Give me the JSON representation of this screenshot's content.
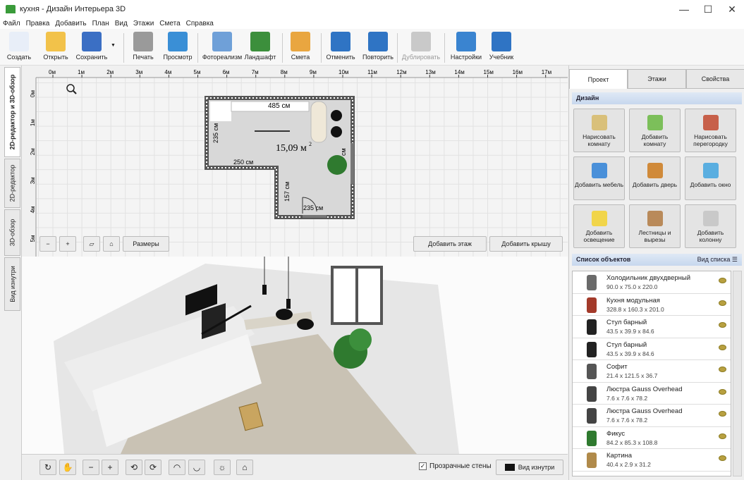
{
  "window": {
    "title": "кухня - Дизайн Интерьера 3D",
    "min": "—",
    "max": "☐",
    "close": "✕"
  },
  "menu": [
    "Файл",
    "Правка",
    "Добавить",
    "План",
    "Вид",
    "Этажи",
    "Смета",
    "Справка"
  ],
  "toolbar": [
    {
      "label": "Создать",
      "icon": "new-file-icon",
      "color": "#e8eef8"
    },
    {
      "label": "Открыть",
      "icon": "folder-icon",
      "color": "#f2c24a"
    },
    {
      "label": "Сохранить",
      "icon": "floppy-icon",
      "color": "#3b6fc4"
    },
    {
      "label": "Печать",
      "icon": "printer-icon",
      "color": "#9a9a9a"
    },
    {
      "label": "Просмотр",
      "icon": "monitor-icon",
      "color": "#3a8fd6"
    },
    {
      "label": "Фотореализм",
      "icon": "photo-icon",
      "color": "#6fa0d8"
    },
    {
      "label": "Ландшафт",
      "icon": "tree-icon",
      "color": "#3c8f3c"
    },
    {
      "label": "Смета",
      "icon": "estimate-icon",
      "color": "#e9a640"
    },
    {
      "label": "Отменить",
      "icon": "undo-icon",
      "color": "#2f74c4"
    },
    {
      "label": "Повторить",
      "icon": "redo-icon",
      "color": "#2f74c4"
    },
    {
      "label": "Дублировать",
      "icon": "duplicate-icon",
      "color": "#c9c9c9"
    },
    {
      "label": "Настройки",
      "icon": "gear-icon",
      "color": "#3a84d0"
    },
    {
      "label": "Учебник",
      "icon": "help-icon",
      "color": "#2f74c4"
    }
  ],
  "left_tabs": [
    "2D-редактор и 3D-обзор",
    "2D-редактор",
    "3D-обзор",
    "Вид изнутри"
  ],
  "ruler_x": [
    "0м",
    "1м",
    "2м",
    "3м",
    "4м",
    "5м",
    "6м",
    "7м",
    "8м",
    "9м",
    "10м",
    "11м",
    "12м",
    "13м",
    "14м",
    "15м",
    "16м",
    "17м"
  ],
  "ruler_y": [
    "0м",
    "1м",
    "2м",
    "3м",
    "4м",
    "5м"
  ],
  "plan": {
    "dim_top": "485 см",
    "dim_left": "235 см",
    "area": "15,09 м",
    "area_sup": "2",
    "dim_mid": "250 см",
    "dim_vert": "157 см",
    "dim_bottom": "235 см",
    "dim_right": "см",
    "sizes_label": "Размеры",
    "add_floor": "Добавить этаж",
    "add_roof": "Добавить крышу"
  },
  "right_tabs": [
    "Проект",
    "Этажи",
    "Свойства"
  ],
  "design_header": "Дизайн",
  "design_buttons": [
    {
      "label": "Нарисовать комнату",
      "icon": "draw-room-icon",
      "color": "#d9c07a"
    },
    {
      "label": "Добавить комнату",
      "icon": "add-room-icon",
      "color": "#7cbf5a"
    },
    {
      "label": "Нарисовать перегородку",
      "icon": "brick-wall-icon",
      "color": "#c7604a"
    },
    {
      "label": "Добавить мебель",
      "icon": "armchair-icon",
      "color": "#4a90d9"
    },
    {
      "label": "Добавить дверь",
      "icon": "door-icon",
      "color": "#d08a3a"
    },
    {
      "label": "Добавить окно",
      "icon": "window-icon",
      "color": "#5aaee0"
    },
    {
      "label": "Добавить освещение",
      "icon": "bulb-icon",
      "color": "#f1d54a"
    },
    {
      "label": "Лестницы и вырезы",
      "icon": "stairs-icon",
      "color": "#b98a5a"
    },
    {
      "label": "Добавить колонну",
      "icon": "column-icon",
      "color": "#c9c9c9"
    }
  ],
  "objects_header": "Список объектов",
  "list_view": "Вид списка",
  "objects": [
    {
      "name": "Холодильник двухдверный",
      "dims": "90.0 x 75.0 x 220.0",
      "icon": "fridge-icon",
      "color": "#6a6a6a"
    },
    {
      "name": "Кухня модульная",
      "dims": "328.8 x 160.3 x 201.0",
      "icon": "kitchen-icon",
      "color": "#a33a2a"
    },
    {
      "name": "Стул барный",
      "dims": "43.5 x 39.9 x 84.6",
      "icon": "bar-stool-icon",
      "color": "#222222"
    },
    {
      "name": "Стул барный",
      "dims": "43.5 x 39.9 x 84.6",
      "icon": "bar-stool-icon",
      "color": "#222222"
    },
    {
      "name": "Софит",
      "dims": "21.4 x 121.5 x 36.7",
      "icon": "spotlight-icon",
      "color": "#555555"
    },
    {
      "name": "Люстра Gauss Overhead",
      "dims": "7.6 x 7.6 x 78.2",
      "icon": "pendant-lamp-icon",
      "color": "#444444"
    },
    {
      "name": "Люстра Gauss Overhead",
      "dims": "7.6 x 7.6 x 78.2",
      "icon": "pendant-lamp-icon",
      "color": "#444444"
    },
    {
      "name": "Фикус",
      "dims": "84.2 x 85.3 x 108.8",
      "icon": "ficus-icon",
      "color": "#2f7a2f"
    },
    {
      "name": "Картина",
      "dims": "40.4 x 2.9 x 31.2",
      "icon": "picture-icon",
      "color": "#b08a4a"
    }
  ],
  "bottom": {
    "transparent_walls": "Прозрачные стены",
    "inside_view": "Вид изнутри",
    "checked": "✓"
  }
}
